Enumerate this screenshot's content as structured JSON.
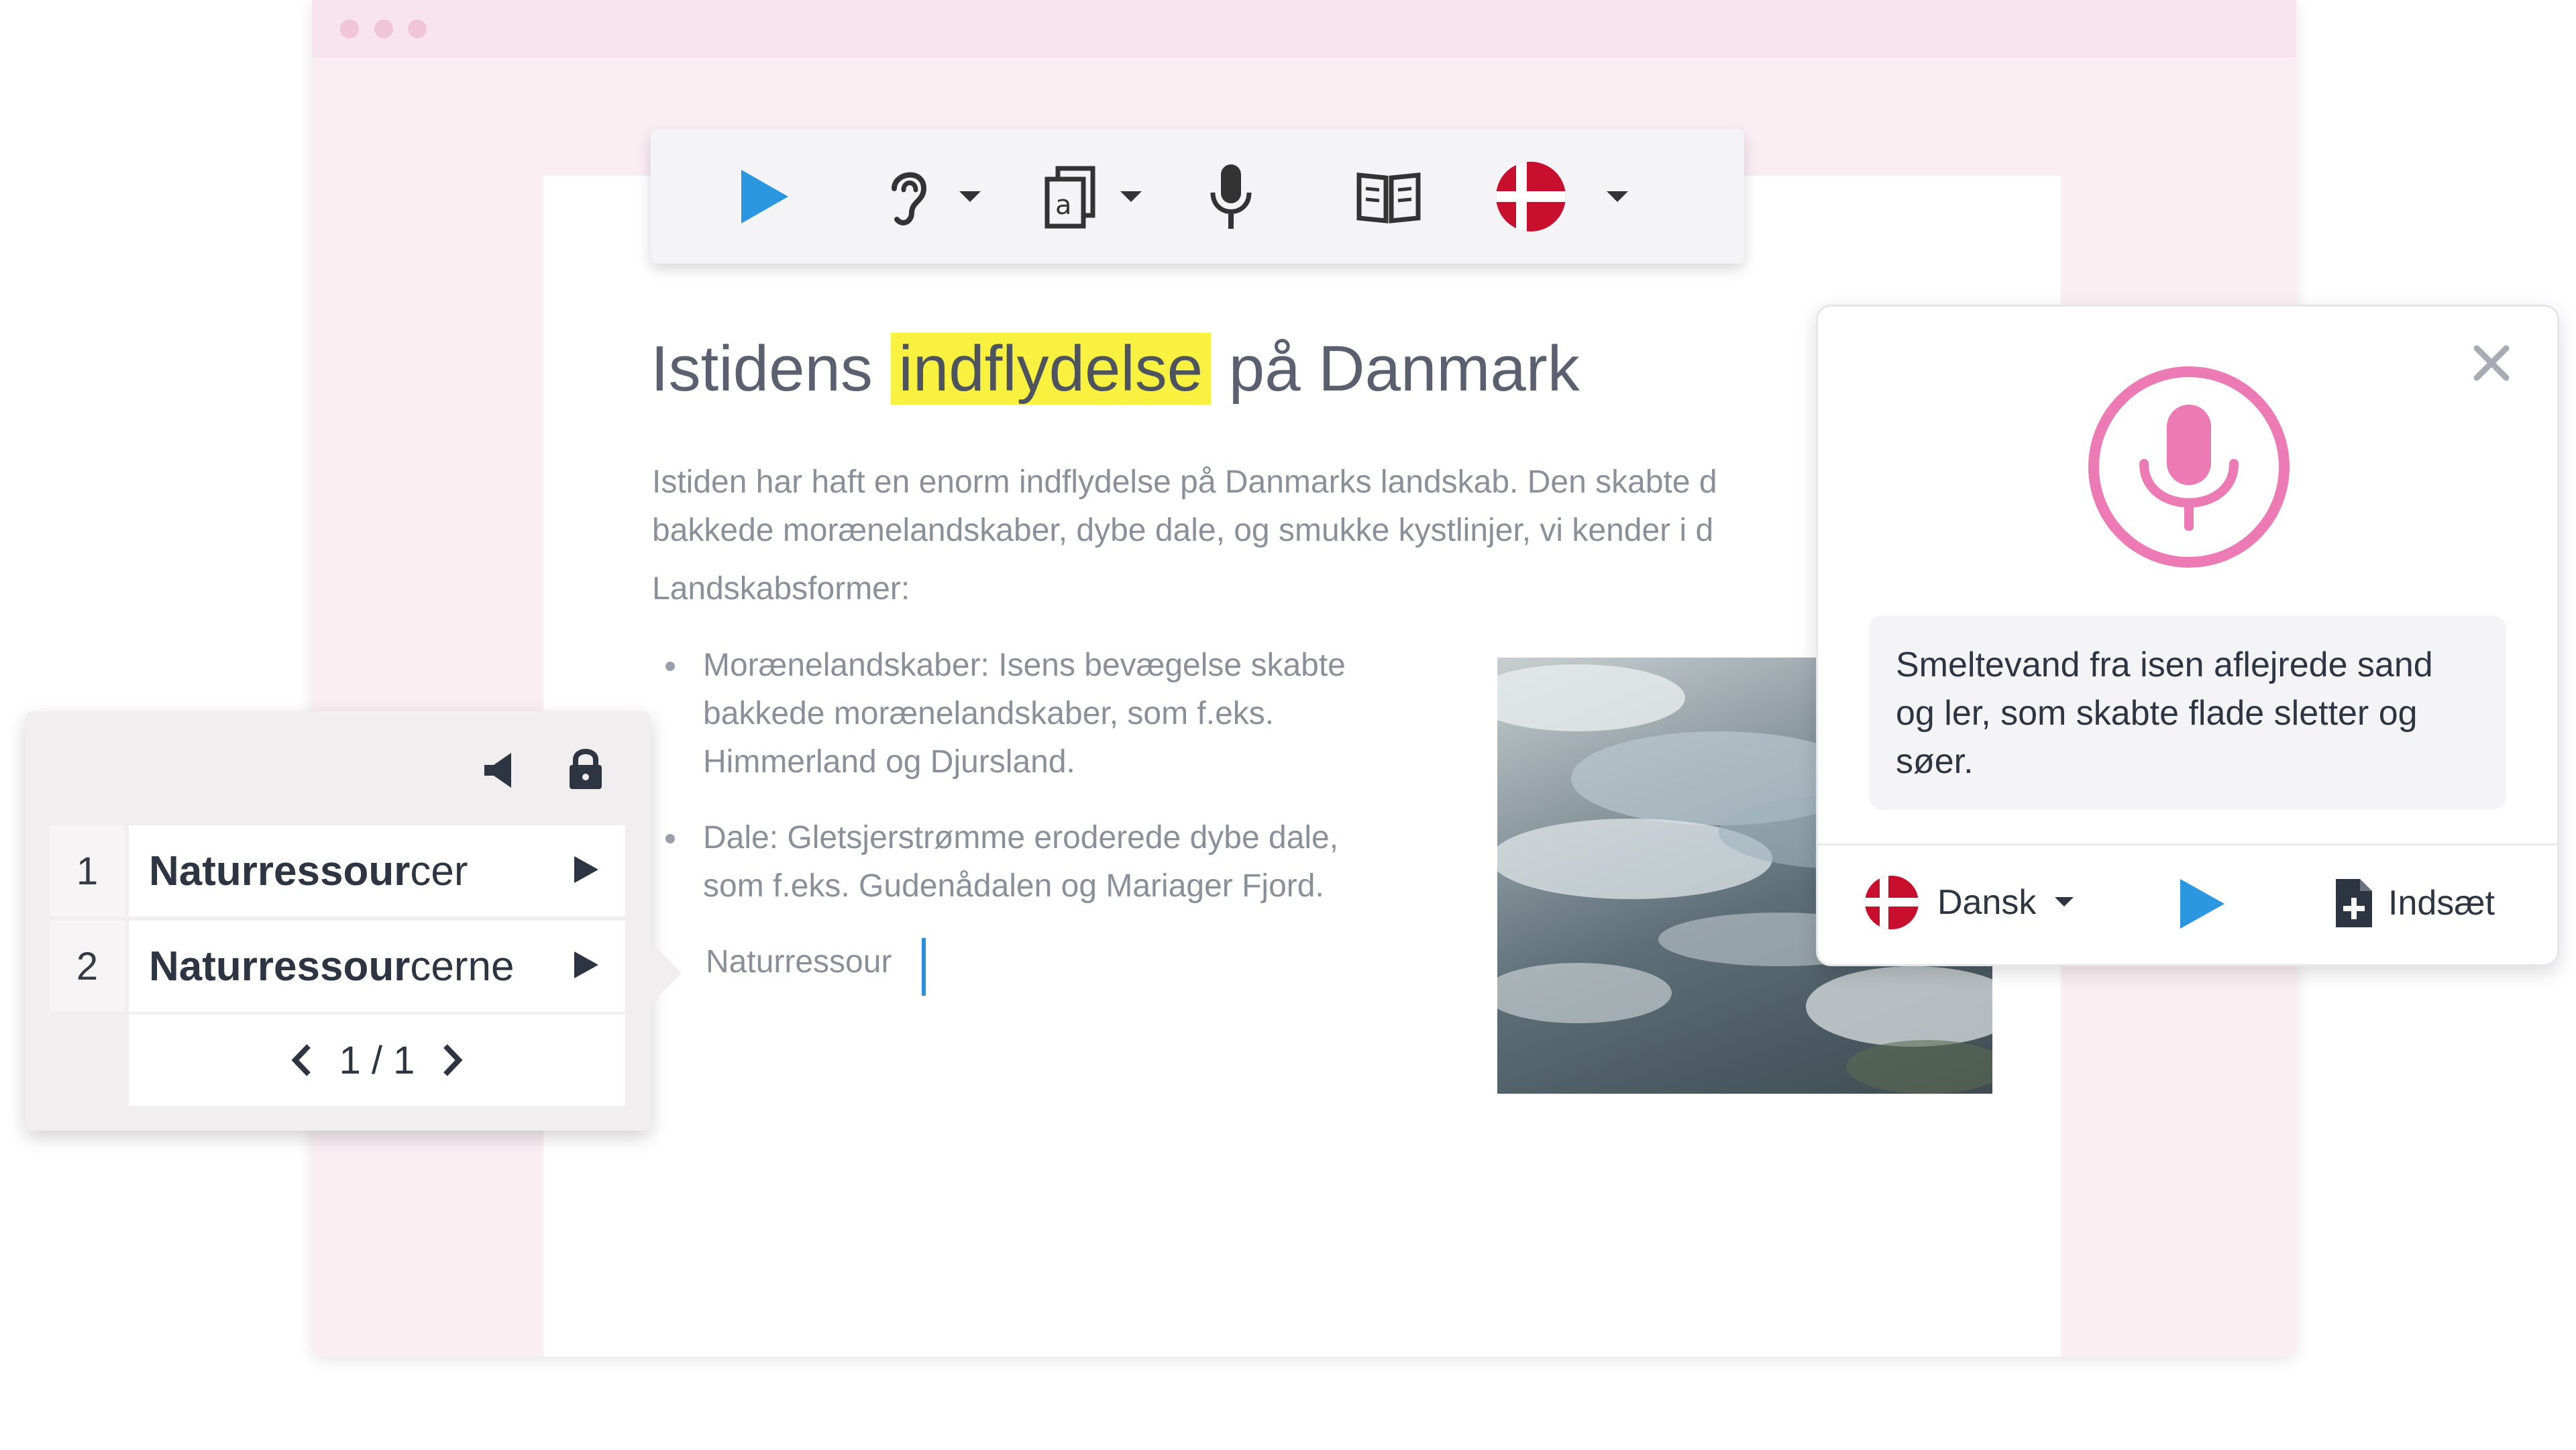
{
  "toolbar": {
    "buttons": [
      "play-icon",
      "ear-icon",
      "word-prediction-icon",
      "microphone-icon",
      "dictionary-icon",
      "danish-flag-icon"
    ],
    "accent_color": "#2a97e0"
  },
  "article": {
    "title_before": "Istidens",
    "title_highlight": "indflydelse",
    "title_after": "på Danmark",
    "highlight_color": "#f8f140",
    "para_line1": "Istiden har haft en enorm indflydelse på Danmarks landskab. Den skabte d",
    "para_line2": "bakkede morænelandskaber, dybe dale, og smukke kystlinjer, vi kender i d",
    "subheading": "Landskabsformer:",
    "bullets": [
      {
        "lines": [
          "Morænelandskaber: Isens bevægelse skabte",
          "bakkede morænelandskaber, som f.eks.",
          "Himmerland og Djursland."
        ]
      },
      {
        "lines": [
          "Dale: Gletsjerstrømme eroderede dybe dale,",
          "som f.eks. Gudenådalen og Mariager Fjord."
        ]
      }
    ],
    "typed_text": "Naturressour"
  },
  "prediction": {
    "items": [
      {
        "num": "1",
        "bold": "Naturressour",
        "rest": "cer"
      },
      {
        "num": "2",
        "bold": "Naturressour",
        "rest": "cerne"
      }
    ],
    "page": "1 / 1"
  },
  "dictation": {
    "mic_color": "#ec7ab5",
    "text": "Smeltevand fra isen aflejrede sand og ler, som skabte flade sletter og søer.",
    "language": "Dansk",
    "insert_label": "Indsæt"
  }
}
